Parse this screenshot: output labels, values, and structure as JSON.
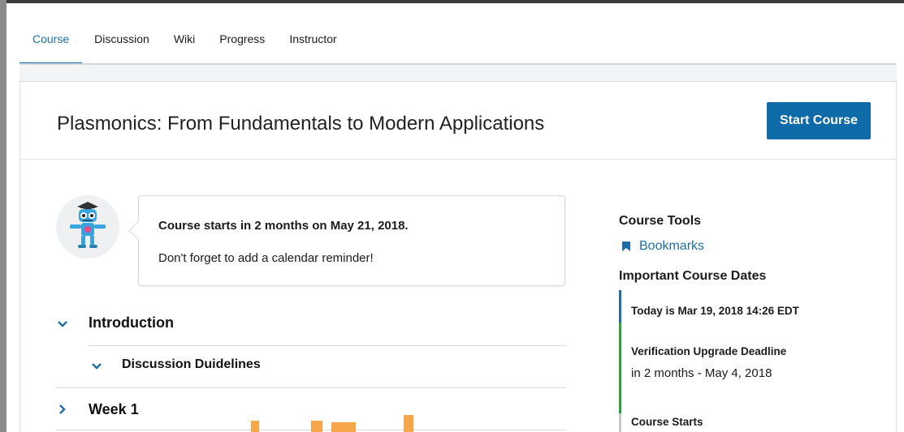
{
  "tabs": [
    {
      "label": "Course",
      "active": true
    },
    {
      "label": "Discussion",
      "active": false
    },
    {
      "label": "Wiki",
      "active": false
    },
    {
      "label": "Progress",
      "active": false
    },
    {
      "label": "Instructor",
      "active": false
    }
  ],
  "header": {
    "title": "Plasmonics: From Fundamentals to Modern Applications",
    "start_button": "Start Course"
  },
  "welcome": {
    "line1": "Course starts in 2 months on May 21, 2018.",
    "line2": "Don't forget to add a calendar reminder!"
  },
  "outline": [
    {
      "label": "Introduction",
      "expanded": true,
      "level": 0
    },
    {
      "label": "Discussion Duidelines",
      "expanded": true,
      "level": 1
    },
    {
      "label": "Week 1",
      "expanded": false,
      "level": 0
    }
  ],
  "sidebar": {
    "tools_heading": "Course Tools",
    "bookmarks_label": "Bookmarks",
    "dates_heading": "Important Course Dates",
    "today": "Today is Mar 19, 2018 14:26 EDT",
    "verification_title": "Verification Upgrade Deadline",
    "verification_detail": "in 2 months - May 4, 2018",
    "course_starts": "Course Starts"
  },
  "colors": {
    "accent": "#1f6fa6",
    "button": "#0e6ba8",
    "timeline_current": "#1f6fa6",
    "timeline_verified": "#2e9e44"
  },
  "icons": {
    "bookmark": "bookmark-icon",
    "expand": "chevron-down-icon",
    "collapse": "chevron-right-icon"
  }
}
